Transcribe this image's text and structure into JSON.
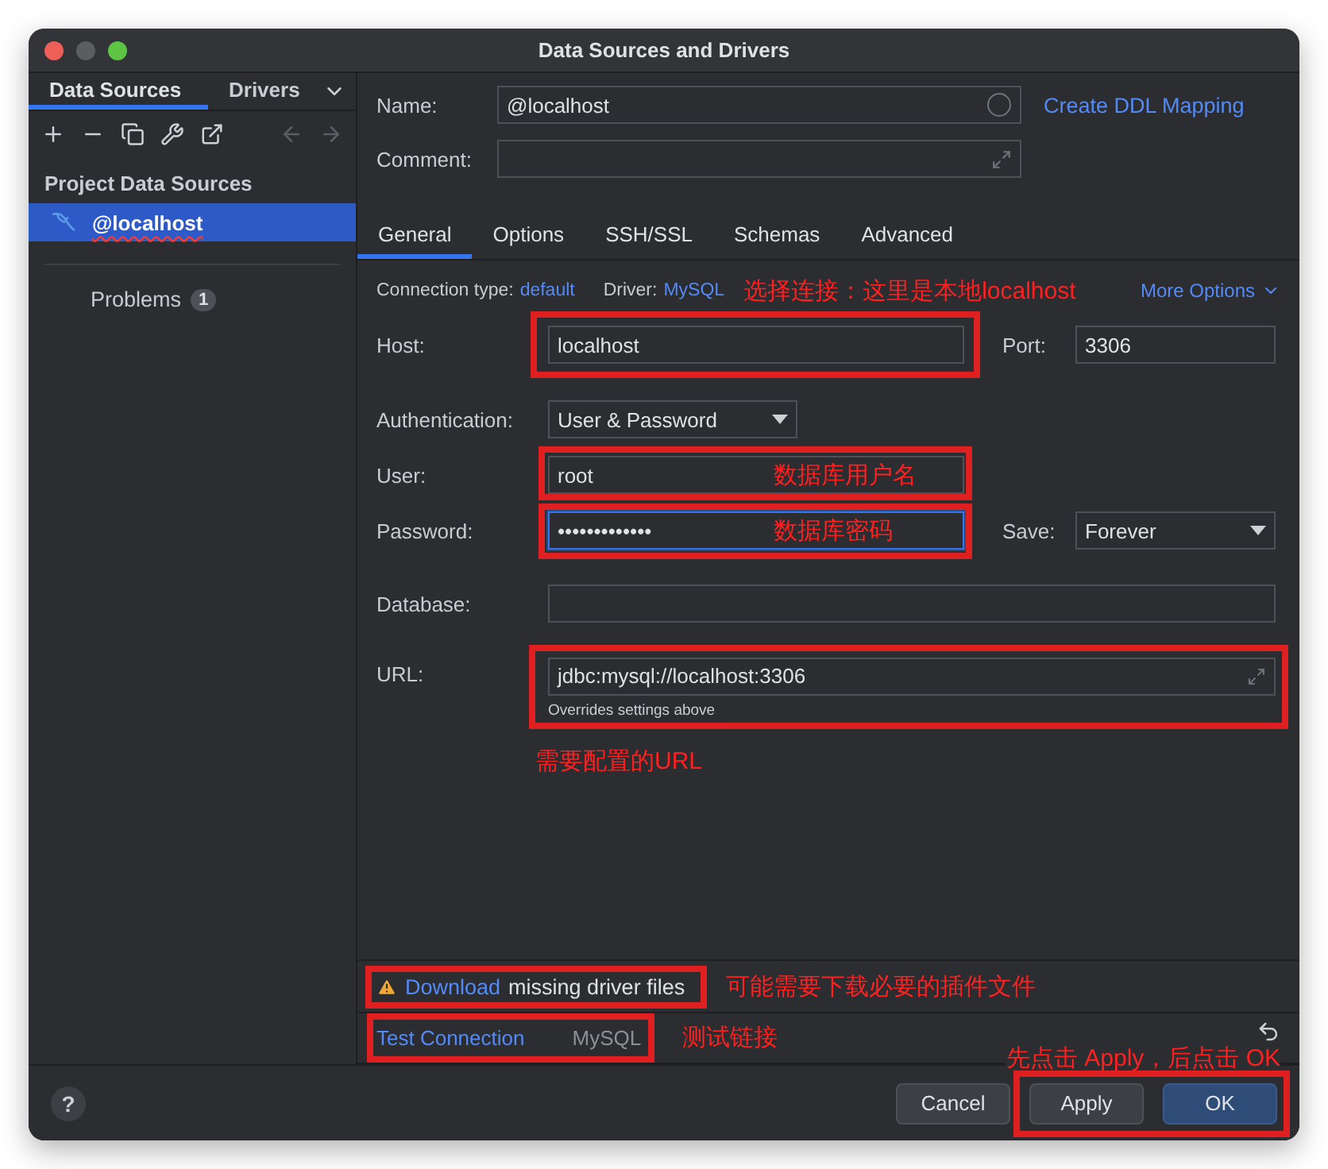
{
  "window": {
    "title": "Data Sources and Drivers"
  },
  "sidebar": {
    "tabs": [
      {
        "label": "Data Sources",
        "selected": true
      },
      {
        "label": "Drivers",
        "selected": false
      }
    ],
    "section_title": "Project Data Sources",
    "items": [
      {
        "label": "@localhost",
        "selected": true
      }
    ],
    "problems": {
      "label": "Problems",
      "count": "1"
    }
  },
  "name": {
    "label": "Name:",
    "value": "@localhost"
  },
  "create_ddl_link": "Create DDL Mapping",
  "comment": {
    "label": "Comment:"
  },
  "tabs": [
    {
      "label": "General",
      "selected": true
    },
    {
      "label": "Options",
      "selected": false
    },
    {
      "label": "SSH/SSL",
      "selected": false
    },
    {
      "label": "Schemas",
      "selected": false
    },
    {
      "label": "Advanced",
      "selected": false
    }
  ],
  "connection": {
    "type_label": "Connection type:",
    "type_value": "default",
    "driver_label": "Driver:",
    "driver_value": "MySQL",
    "note": "选择连接：这里是本地localhost",
    "more_options": "More Options"
  },
  "host": {
    "label": "Host:",
    "value": "localhost",
    "highlighted": true
  },
  "port": {
    "label": "Port:",
    "value": "3306"
  },
  "authentication": {
    "label": "Authentication:",
    "value": "User & Password"
  },
  "user": {
    "label": "User:",
    "value": "root",
    "note": "数据库用户名",
    "highlighted": true
  },
  "password": {
    "label": "Password:",
    "value": "•••••••••••••",
    "note": "数据库密码",
    "highlighted": true,
    "focused": true
  },
  "save": {
    "label": "Save:",
    "value": "Forever"
  },
  "database": {
    "label": "Database:"
  },
  "url": {
    "label": "URL:",
    "value": "jdbc:mysql://localhost:3306",
    "hint": "Overrides settings above",
    "note": "需要配置的URL",
    "highlighted": true
  },
  "warning": {
    "link": "Download",
    "text": "missing driver files",
    "note": "可能需要下载必要的插件文件",
    "highlighted": true
  },
  "test": {
    "link": "Test Connection",
    "driver": "MySQL",
    "note": "测试链接",
    "highlighted": true
  },
  "footer": {
    "help": "?",
    "note": "先点击 Apply，后点击 OK",
    "buttons_highlighted": true,
    "buttons": [
      {
        "label": "Cancel",
        "kind": "normal"
      },
      {
        "label": "Apply",
        "kind": "normal"
      },
      {
        "label": "OK",
        "kind": "default"
      }
    ]
  }
}
